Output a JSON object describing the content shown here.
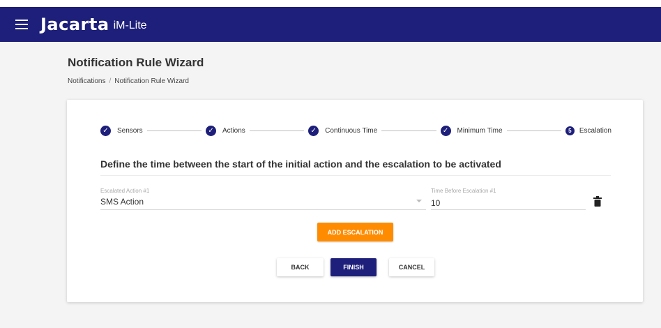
{
  "header": {
    "brand": "Jacarta",
    "product": "iM-Lite",
    "menu_icon": "hamburger-menu-icon"
  },
  "page": {
    "title": "Notification Rule Wizard",
    "breadcrumb": [
      {
        "label": "Notifications"
      },
      {
        "label": "Notification Rule Wizard"
      }
    ],
    "breadcrumb_separator": "/"
  },
  "stepper": {
    "steps": [
      {
        "label": "Sensors",
        "state": "complete",
        "icon": "check-circle-icon"
      },
      {
        "label": "Actions",
        "state": "complete",
        "icon": "check-circle-icon"
      },
      {
        "label": "Continuous Time",
        "state": "complete",
        "icon": "check-circle-icon"
      },
      {
        "label": "Minimum Time",
        "state": "complete",
        "icon": "check-circle-icon"
      },
      {
        "label": "Escalation",
        "state": "active",
        "number": "5"
      }
    ]
  },
  "form": {
    "heading": "Define the time between the start of the initial action and the escalation to be activated",
    "escalated_action_label": "Escalated Action #1",
    "escalated_action_value": "SMS Action",
    "time_label": "Time Before Escalation #1",
    "time_value": "10",
    "delete_icon": "trash-icon"
  },
  "buttons": {
    "add_escalation": "ADD ESCALATION",
    "back": "BACK",
    "finish": "FINISH",
    "cancel": "CANCEL"
  },
  "colors": {
    "primary": "#1d1f7a",
    "accent": "#ff8c00"
  }
}
